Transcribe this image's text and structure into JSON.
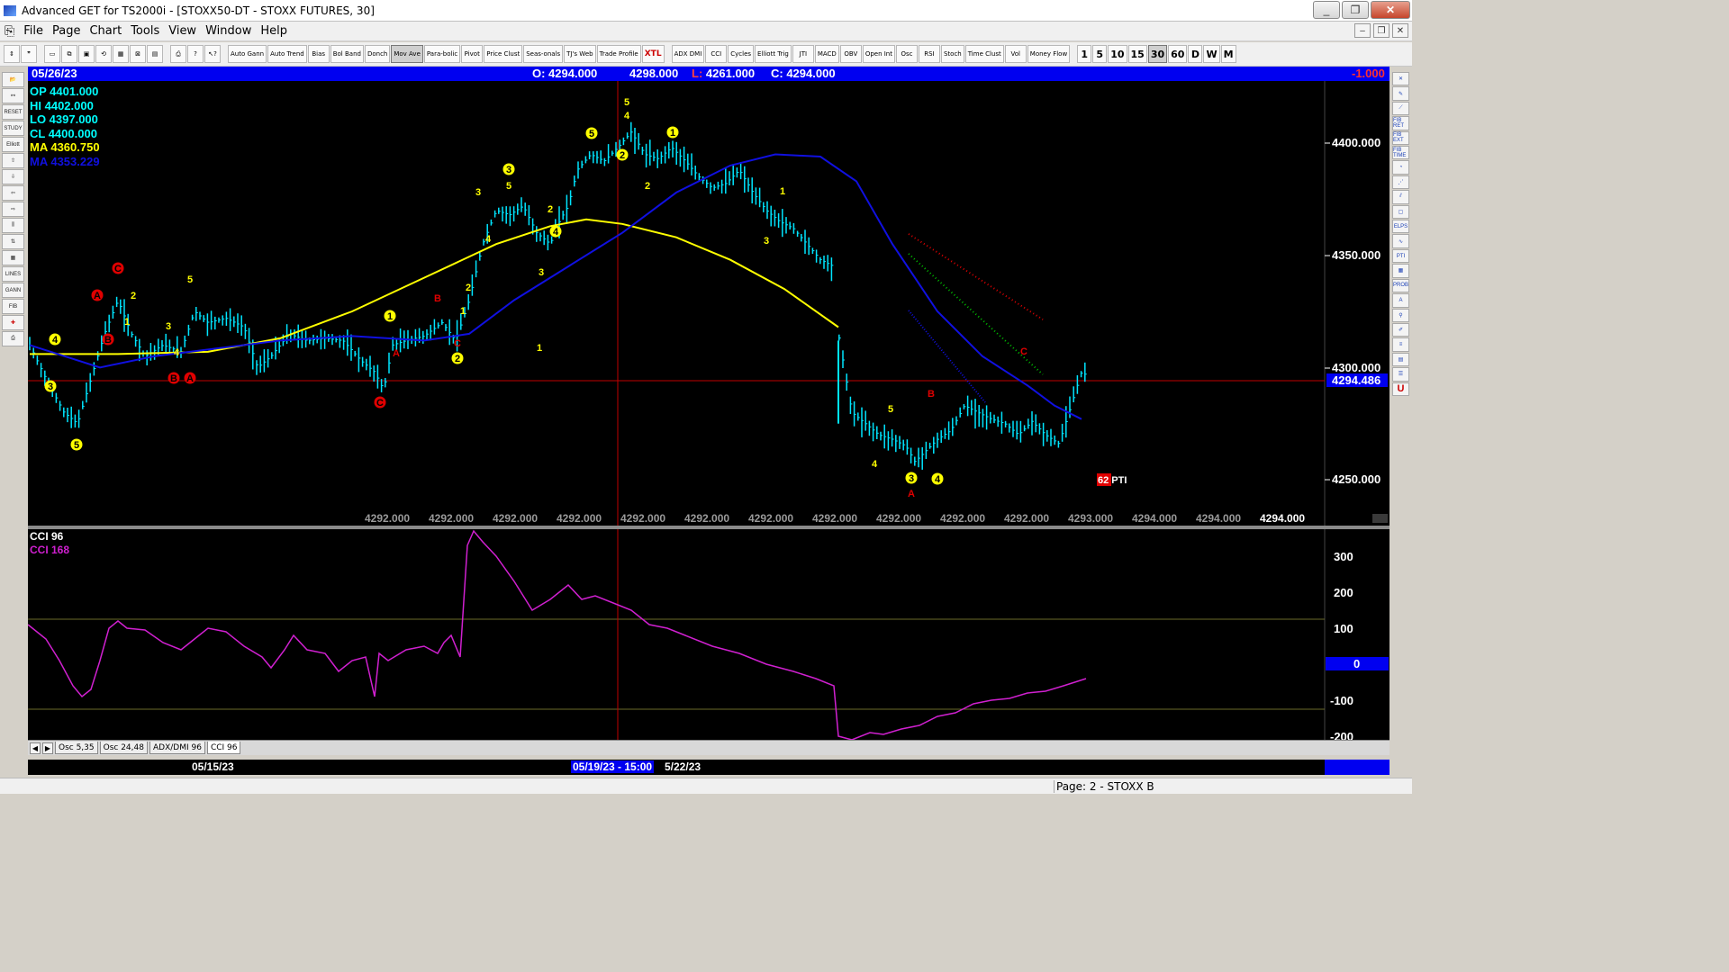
{
  "window": {
    "title": "Advanced GET for TS2000i - [STOXX50-DT - STOXX FUTURES, 30]",
    "buttons": [
      "_",
      "❐",
      "✕"
    ]
  },
  "menu": [
    "File",
    "Page",
    "Chart",
    "Tools",
    "View",
    "Window",
    "Help"
  ],
  "toolbar": {
    "buttons": [
      "Auto Gann",
      "Auto Trend",
      "Bias",
      "Bol Band",
      "Donch",
      "Mov Ave",
      "Para-bolic",
      "Pivot",
      "Price Clust",
      "Seas-onals",
      "TJ's Web",
      "Trade Profile",
      "XTL",
      "ADX DMI",
      "CCI",
      "Cycles",
      "Elliott Trig",
      "JTI",
      "MACD",
      "OBV",
      "Open Int",
      "Osc",
      "RSI",
      "Stoch",
      "Time Clust",
      "Vol",
      "Money Flow"
    ],
    "intervals": [
      "1",
      "5",
      "10",
      "15",
      "30",
      "60",
      "D",
      "W",
      "M"
    ],
    "active_interval": "30"
  },
  "left_tools": [
    "RESET",
    "STUDY",
    "Elliott",
    "LINES",
    "GANN",
    "FIB"
  ],
  "right_tools": [
    "FIB RET",
    "FIB EXT",
    "FIB TIME",
    "ELPS",
    "PTI",
    "PROB",
    "A",
    "U"
  ],
  "infobar": {
    "date": "05/26/23",
    "open": "O: 4294.000",
    "high": "4298.000",
    "low": "L: 4261.000",
    "close": "C: 4294.000",
    "change": "-1.000"
  },
  "stats": {
    "op": "OP  4401.000",
    "hi": "HI   4402.000",
    "lo": "LO  4397.000",
    "cl": "CL  4400.000",
    "ma": "MA  4360.750",
    "ma2": "MA  4353.229"
  },
  "price_axis": {
    "labels": [
      "4400.000",
      "4350.000",
      "4300.000",
      "4250.000"
    ],
    "current": "4294.486"
  },
  "bottom_values": [
    "4292.000",
    "4292.000",
    "4292.000",
    "4292.000",
    "4292.000",
    "4292.000",
    "4292.000",
    "4292.000",
    "4292.000",
    "4292.000",
    "4292.000",
    "4293.000",
    "4294.000",
    "4294.000",
    "4294.000"
  ],
  "pti_label": "62 PTI",
  "cci": {
    "label1": "CCI 96",
    "label2": "CCI  168",
    "axis": [
      "300",
      "200",
      "100",
      "0",
      "-100",
      "-200"
    ]
  },
  "tabs": [
    "Osc 5,35",
    "Osc 24,48",
    "ADX/DMI 96",
    "CCI 96"
  ],
  "dates": {
    "d1": "05/15/23",
    "d2": "05/19/23 - 15:00",
    "d3": "5/22/23"
  },
  "status": {
    "page": "Page: 2 - STOXX B"
  },
  "colors": {
    "background": "#000000",
    "ma_yellow": "#ffff00",
    "ma_blue": "#1010e0",
    "bars": "#00e5ff",
    "cci": "#d020d0",
    "wave_red": "#e00000",
    "infobar": "#0000f0"
  },
  "wave_labels": [
    {
      "t": "4",
      "c": "circle-yellow"
    },
    {
      "t": "3",
      "c": "circle-yellow"
    },
    {
      "t": "5",
      "c": "circle-yellow"
    },
    {
      "t": "A",
      "c": "circle-red"
    },
    {
      "t": "B",
      "c": "circle-red"
    },
    {
      "t": "C",
      "c": "circle-red"
    },
    {
      "t": "1",
      "c": "yellow"
    },
    {
      "t": "2",
      "c": "yellow"
    },
    {
      "t": "3",
      "c": "yellow"
    },
    {
      "t": "4",
      "c": "yellow"
    },
    {
      "t": "5",
      "c": "yellow"
    },
    {
      "t": "B",
      "c": "circle-red"
    },
    {
      "t": "A",
      "c": "circle-red"
    },
    {
      "t": "1",
      "c": "circle-yellow"
    },
    {
      "t": "A",
      "c": "red"
    },
    {
      "t": "C",
      "c": "circle-red"
    },
    {
      "t": "B",
      "c": "red"
    },
    {
      "t": "C",
      "c": "red"
    },
    {
      "t": "1",
      "c": "yellow"
    },
    {
      "t": "2",
      "c": "circle-yellow"
    },
    {
      "t": "2",
      "c": "yellow"
    },
    {
      "t": "3",
      "c": "yellow"
    },
    {
      "t": "4",
      "c": "yellow"
    },
    {
      "t": "3",
      "c": "circle-yellow"
    },
    {
      "t": "5",
      "c": "yellow"
    },
    {
      "t": "1",
      "c": "yellow"
    },
    {
      "t": "2",
      "c": "yellow"
    },
    {
      "t": "4",
      "c": "circle-yellow"
    },
    {
      "t": "3",
      "c": "yellow"
    },
    {
      "t": "5",
      "c": "circle-yellow"
    },
    {
      "t": "5",
      "c": "yellow"
    },
    {
      "t": "4",
      "c": "yellow"
    },
    {
      "t": "2",
      "c": "circle-yellow"
    },
    {
      "t": "1",
      "c": "circle-yellow"
    },
    {
      "t": "2",
      "c": "yellow"
    },
    {
      "t": "1",
      "c": "yellow"
    },
    {
      "t": "3",
      "c": "yellow"
    },
    {
      "t": "4",
      "c": "yellow"
    },
    {
      "t": "5",
      "c": "yellow"
    },
    {
      "t": "3",
      "c": "circle-yellow"
    },
    {
      "t": "A",
      "c": "red"
    },
    {
      "t": "B",
      "c": "red"
    },
    {
      "t": "4",
      "c": "circle-yellow"
    },
    {
      "t": "C",
      "c": "red"
    }
  ]
}
